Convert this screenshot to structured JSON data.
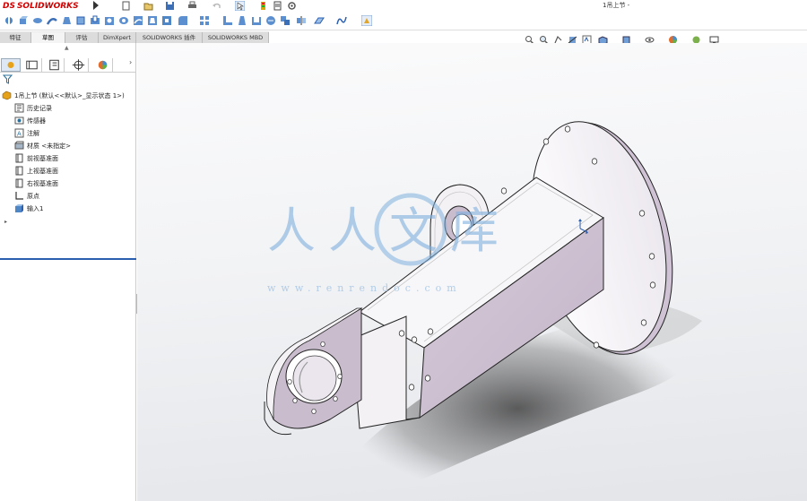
{
  "app": {
    "logo_ds": "DS",
    "logo_name": "SOLIDWORKS",
    "document_title": "1吊上节 -"
  },
  "tabs": [
    {
      "label": "特征",
      "active": false
    },
    {
      "label": "草图",
      "active": true
    },
    {
      "label": "评估",
      "active": false
    },
    {
      "label": "DimXpert",
      "active": false
    },
    {
      "label": "SOLIDWORKS 插件",
      "active": false
    },
    {
      "label": "SOLIDWORKS MBD",
      "active": false
    }
  ],
  "feature_tree": {
    "root": "1吊上节 (默认<<默认>_显示状态 1>)",
    "items": [
      {
        "label": "历史记录",
        "icon": "history-icon"
      },
      {
        "label": "传感器",
        "icon": "sensor-icon"
      },
      {
        "label": "注解",
        "icon": "annotation-icon"
      },
      {
        "label": "材质 <未指定>",
        "icon": "material-icon"
      },
      {
        "label": "前视基准面",
        "icon": "plane-icon"
      },
      {
        "label": "上视基准面",
        "icon": "plane-icon"
      },
      {
        "label": "右视基准面",
        "icon": "plane-icon"
      },
      {
        "label": "原点",
        "icon": "origin-icon"
      },
      {
        "label": "输入1",
        "icon": "imported-body-icon"
      }
    ]
  },
  "watermark": {
    "text": "人人文库",
    "url": "www.renrendoc.com"
  },
  "colors": {
    "part_face": "#cbbfcf",
    "part_light": "#f6f4f7",
    "accent_blue": "#2a5fb0",
    "brand_red": "#d40000",
    "watermark_blue": "#7fb0de"
  }
}
